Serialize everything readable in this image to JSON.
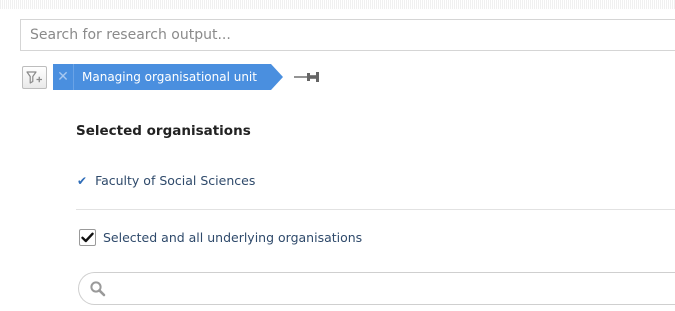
{
  "search": {
    "placeholder": "Search for research output...",
    "value": ""
  },
  "filters": {
    "add_filter_icon": "filter-plus-icon",
    "chips": [
      {
        "label": "Managing organisational unit",
        "remove_icon": "close-icon"
      }
    ],
    "pin_icon": "pin-icon"
  },
  "panel": {
    "title": "Selected organisations",
    "selected_items": [
      {
        "label": "Faculty of Social Sciences",
        "icon": "checkmark-icon"
      }
    ],
    "include_underlying": {
      "label": "Selected and all underlying organisations",
      "checked": true
    },
    "org_search": {
      "placeholder": "",
      "value": "",
      "icon": "search-icon"
    }
  },
  "colors": {
    "chip_bg": "#4a8fdf",
    "checkmark": "#2f6db8",
    "link_text": "#2f4a6b"
  }
}
